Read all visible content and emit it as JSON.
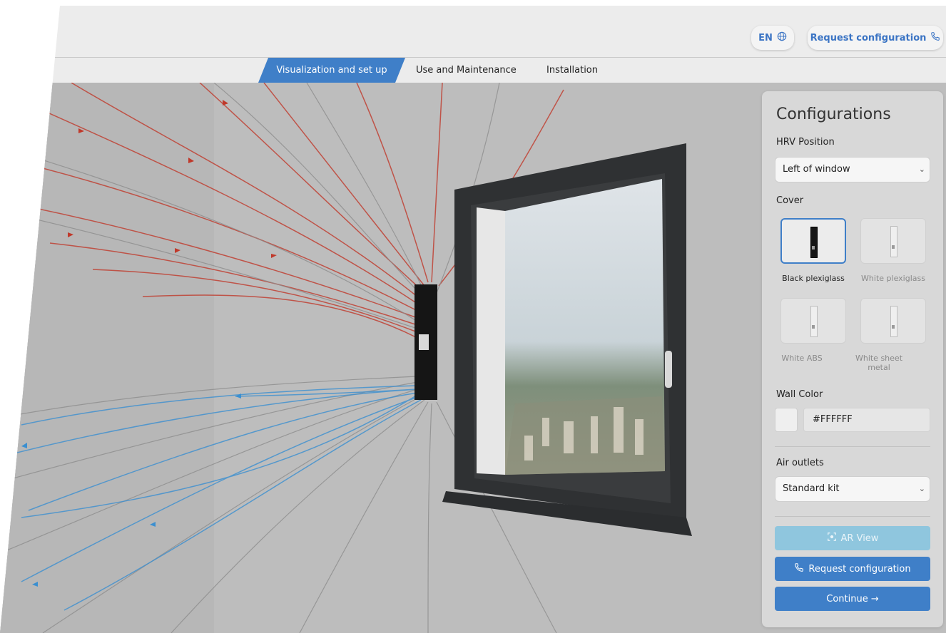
{
  "header": {
    "language": "EN",
    "request_configuration": "Request configuration"
  },
  "tabs": [
    {
      "label": "Visualization and set up",
      "active": true
    },
    {
      "label": "Use and Maintenance",
      "active": false
    },
    {
      "label": "Installation",
      "active": false
    }
  ],
  "panel": {
    "title": "Configurations",
    "hrv_position": {
      "label": "HRV Position",
      "value": "Left of window"
    },
    "cover": {
      "label": "Cover",
      "options": [
        {
          "label": "Black plexiglass",
          "selected": true
        },
        {
          "label": "White plexiglass",
          "selected": false
        },
        {
          "label": "White ABS",
          "selected": false
        },
        {
          "label": "White sheet metal",
          "selected": false
        }
      ]
    },
    "wall_color": {
      "label": "Wall Color",
      "value": "#FFFFFF"
    },
    "air_outlets": {
      "label": "Air outlets",
      "value": "Standard kit"
    },
    "buttons": {
      "ar_view": "AR View",
      "request_configuration": "Request configuration",
      "continue": "Continue →"
    }
  },
  "colors": {
    "accent": "#3f7fc8",
    "ar_button": "#8fc6de",
    "exhaust_flow": "#c0392b",
    "intake_flow": "#3b8fd0",
    "window_frame": "#2f3133",
    "hrv_unit": "#151515"
  },
  "icons": {
    "globe": "globe-icon",
    "phone": "phone-icon",
    "ar": "ar-icon",
    "chevron": "chevron-down-icon"
  }
}
